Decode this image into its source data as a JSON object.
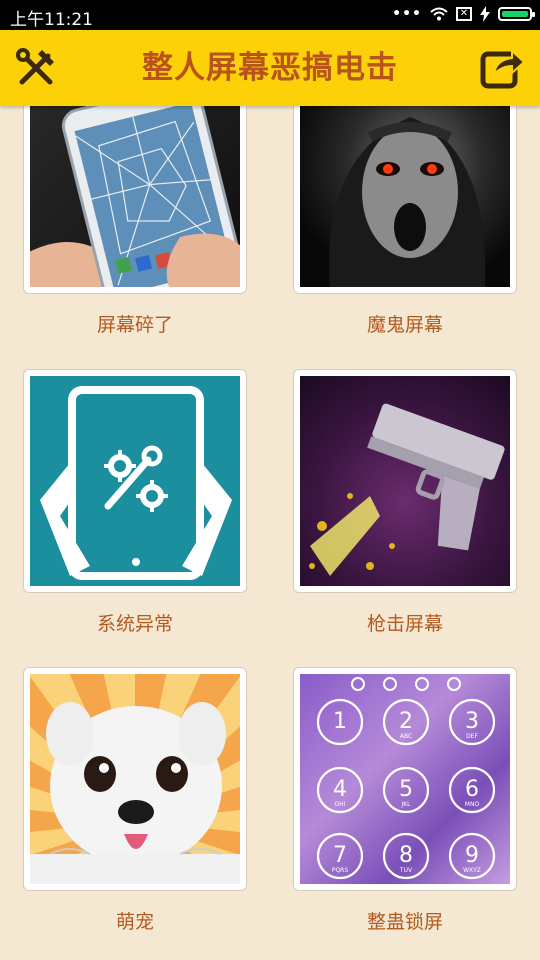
{
  "status_bar": {
    "time": "上午11:21"
  },
  "app_bar": {
    "title": "整人屏幕恶搞电击"
  },
  "items": [
    {
      "label": "屏幕碎了"
    },
    {
      "label": "魔鬼屏幕"
    },
    {
      "label": "系统异常"
    },
    {
      "label": "枪击屏幕"
    },
    {
      "label": "萌宠"
    },
    {
      "label": "整蛊锁屏"
    }
  ],
  "lock_keypad": {
    "keys": [
      "1",
      "2",
      "3",
      "4",
      "5",
      "6",
      "7",
      "8",
      "9"
    ],
    "letters": [
      "",
      "ABC",
      "DEF",
      "GHI",
      "JKL",
      "MNO",
      "PQRS",
      "TUV",
      "WXYZ"
    ]
  },
  "colors": {
    "app_bar": "#fdd108",
    "title": "#b8541a",
    "label": "#b25a1f",
    "background": "#f5e8d3"
  }
}
